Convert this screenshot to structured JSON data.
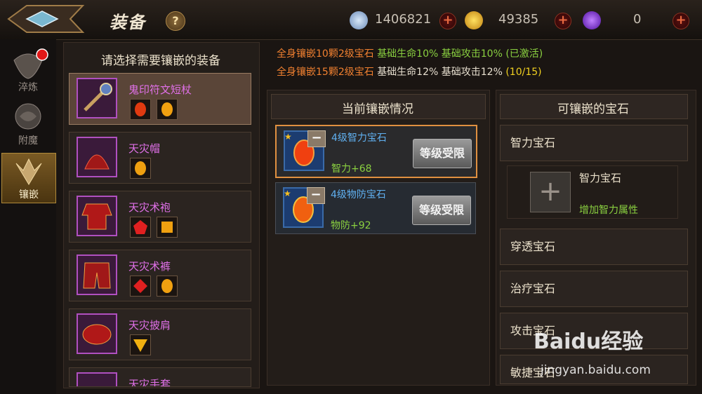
{
  "header": {
    "title": "装备",
    "help": "?",
    "silver": "1406821",
    "gold": "49385",
    "gems": "0",
    "plus": "+",
    "colors": {
      "accent_gold": "#f0b020",
      "purple": "#8a3ce0"
    }
  },
  "tabs": [
    {
      "label": "淬炼"
    },
    {
      "label": "附魔"
    },
    {
      "label": "镶嵌"
    }
  ],
  "left_panel": {
    "title": "请选择需要镶嵌的装备",
    "items": [
      {
        "name": "鬼印符文短杖"
      },
      {
        "name": "天灾帽"
      },
      {
        "name": "天灾术袍"
      },
      {
        "name": "天灾术裤"
      },
      {
        "name": "天灾披肩"
      },
      {
        "name": "天灾手套"
      }
    ]
  },
  "bonus": {
    "line1": {
      "req": "全身镶嵌10颗2级宝石",
      "life": "基础生命10%",
      "atk": "基础攻击10%",
      "status": "(已激活)"
    },
    "line2": {
      "req": "全身镶嵌15颗2级宝石",
      "life": "基础生命12%",
      "atk": "基础攻击12%",
      "status": "(10/15)"
    }
  },
  "current": {
    "title": "当前镶嵌情况",
    "gems": [
      {
        "name": "4级智力宝石",
        "stat": "智力+68",
        "button": "等级受限"
      },
      {
        "name": "4级物防宝石",
        "stat": "物防+92",
        "button": "等级受限"
      }
    ]
  },
  "available": {
    "title": "可镶嵌的宝石",
    "categories": [
      "智力宝石",
      "穿透宝石",
      "治疗宝石",
      "攻击宝石",
      "敏捷宝石"
    ],
    "expanded": {
      "name": "智力宝石",
      "desc": "增加智力属性"
    }
  },
  "watermark": {
    "brand": "Baidu经验",
    "url": "jingyan.baidu.com"
  }
}
